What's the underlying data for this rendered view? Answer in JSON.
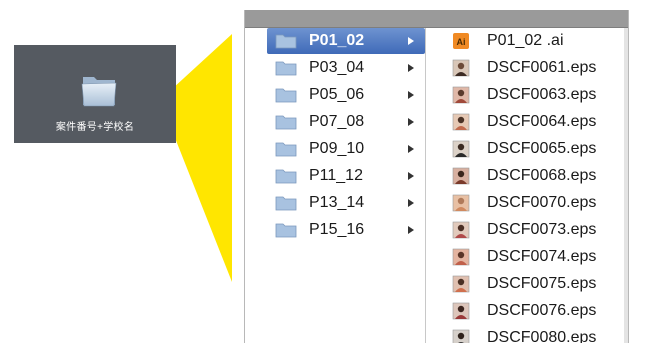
{
  "desktop": {
    "folder_label": "案件番号+学校名",
    "folder_icon": "folder-icon"
  },
  "colors": {
    "callout": "#ffe600",
    "selection": "#3f6ab8",
    "desktop_bg": "#555a61",
    "toolbar": "#9a9a9a"
  },
  "finder": {
    "folders": [
      {
        "label": "P01_02",
        "selected": true
      },
      {
        "label": "P03_04",
        "selected": false
      },
      {
        "label": "P05_06",
        "selected": false
      },
      {
        "label": "P07_08",
        "selected": false
      },
      {
        "label": "P09_10",
        "selected": false
      },
      {
        "label": "P11_12",
        "selected": false
      },
      {
        "label": "P13_14",
        "selected": false
      },
      {
        "label": "P15_16",
        "selected": false
      }
    ],
    "files": [
      {
        "label": "P01_02 .ai",
        "icon": "illustrator-file-icon"
      },
      {
        "label": "DSCF0061.eps",
        "icon": "photo-thumbnail-icon"
      },
      {
        "label": "DSCF0063.eps",
        "icon": "photo-thumbnail-icon"
      },
      {
        "label": "DSCF0064.eps",
        "icon": "photo-thumbnail-icon"
      },
      {
        "label": "DSCF0065.eps",
        "icon": "photo-thumbnail-icon"
      },
      {
        "label": "DSCF0068.eps",
        "icon": "photo-thumbnail-icon"
      },
      {
        "label": "DSCF0070.eps",
        "icon": "photo-thumbnail-icon"
      },
      {
        "label": "DSCF0073.eps",
        "icon": "photo-thumbnail-icon"
      },
      {
        "label": "DSCF0074.eps",
        "icon": "photo-thumbnail-icon"
      },
      {
        "label": "DSCF0075.eps",
        "icon": "photo-thumbnail-icon"
      },
      {
        "label": "DSCF0076.eps",
        "icon": "photo-thumbnail-icon"
      },
      {
        "label": "DSCF0080.eps",
        "icon": "photo-thumbnail-icon"
      }
    ]
  }
}
